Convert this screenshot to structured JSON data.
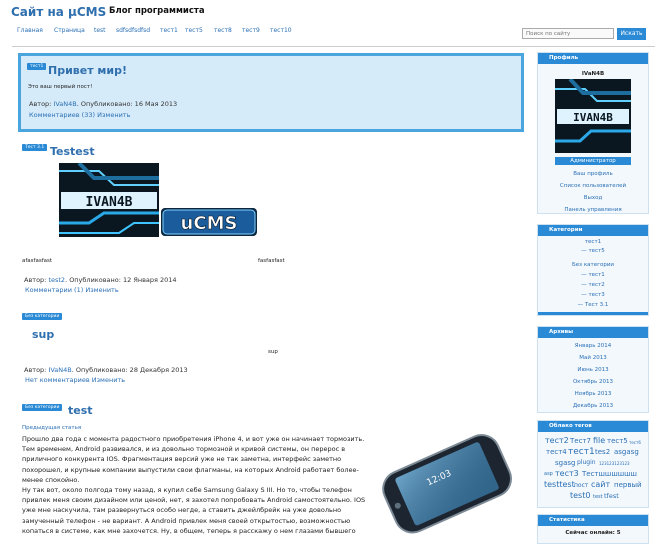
{
  "header": {
    "site_title": "Сайт на µCMS",
    "slogan": "Блог программиста"
  },
  "nav": {
    "items": [
      "Главная",
      "Страница",
      "test",
      "sdfsdfsdfsd",
      "тест1",
      "тест5",
      "тест8",
      "тест9",
      "тест10"
    ]
  },
  "search": {
    "placeholder": "Поиск по сайту",
    "button": "Искать"
  },
  "posts": {
    "p1": {
      "badge": "тест1",
      "title": "Привет мир!",
      "text": "Это ваш первый пост!",
      "meta_prefix": "Автор:",
      "author": "IVaN4B",
      "meta_date": ". Опубликовано: 16 Мая 2013",
      "comments": "Комментариев (33)",
      "edit": "Изменить"
    },
    "p2": {
      "badge": "Тест 3.1",
      "title": "Testest",
      "left_text": "afasfasfast",
      "right_text": "fasfasfast",
      "image_text": "IVAN4B",
      "cms_text": "uCMS",
      "meta_prefix": "Автор:",
      "author": "test2",
      "meta_date": ". Опубликовано: 12 Января 2014",
      "comments": "Комментарии (1)",
      "edit": "Изменить"
    },
    "p3": {
      "badge": "Без категории",
      "title": "sup",
      "text": "sup",
      "meta_prefix": "Автор:",
      "author": "IVaN4B",
      "meta_date": ". Опубликовано: 28 Декабря 2013",
      "comments": "Нет комментариев",
      "edit": "Изменить"
    },
    "p4": {
      "badge": "Без категории",
      "title": "test",
      "prev_link": "Предыдущая статья",
      "paragraph1": "Прошло два года с момента радостного приобретения iPhone 4, и вот уже он начинает тормозить. Тем временем, Android развивался, и из довольно тормозной и кривой системы, он перерос в приличного конкурента IOS. Фрагментация версий уже не так заметна, интерфейс заметно похорошел, и крупные компании выпустили свои флагманы, на которых Android работает более-менее спокойно.",
      "paragraph2": "Ну так вот, около полгода тому назад, я купил себе Samsung Galaxy S III. Но то, чтобы телефон привлек меня своим дизайном или ценой, нет, я захотел попробовать Android самостоятельно. IOS уже мне наскучила, там развернуться особо негде, а ставить джейлбрейк на уже довольно замученный телефон - не вариант. А Android привлек меня своей открытостью, возможностью копаться в системе, как мне захочется. Ну, в общем, теперь я расскажу о нем глазами бывшего",
      "phone_time": "12:03"
    }
  },
  "sidebar": {
    "profile": {
      "head": "Профиль",
      "name": "IVaN4B",
      "avatar_text": "IVAN4B",
      "role": "Администратор",
      "links": [
        "Ваш профиль",
        "Список пользователей",
        "Выход",
        "Панель управления"
      ]
    },
    "categories": {
      "head": "Категории",
      "items": [
        "тест1",
        "— тест5",
        "Без категории",
        "— тест1",
        "— тест2",
        "— тест3",
        "— Тест 3.1"
      ]
    },
    "archive": {
      "head": "Архивы",
      "items": [
        "Январь 2014",
        "Май 2013",
        "Июнь 2013",
        "Октябрь 2013",
        "Ноябрь 2013",
        "Декабрь 2013"
      ]
    },
    "tags": {
      "head": "Облако тегов",
      "items": [
        "тест2",
        "Тест7",
        "file",
        "тест5",
        "тест6",
        "тест4",
        "тест1",
        "tes2",
        "asgasg",
        "sgasg",
        "plugin",
        "123123123123",
        "asp",
        "тест3",
        "Тестшшшшшш",
        "testtest",
        "пост",
        "сайт",
        "первый",
        "test0",
        "test",
        "tfest"
      ]
    },
    "stats": {
      "head": "Статистика",
      "online": "Сейчас онлайн: 5"
    }
  },
  "colors": {
    "accent": "#2a8ad6",
    "link": "#2a6fb5",
    "title": "#2f6fae",
    "highlight_bg": "#d6ebf9"
  }
}
